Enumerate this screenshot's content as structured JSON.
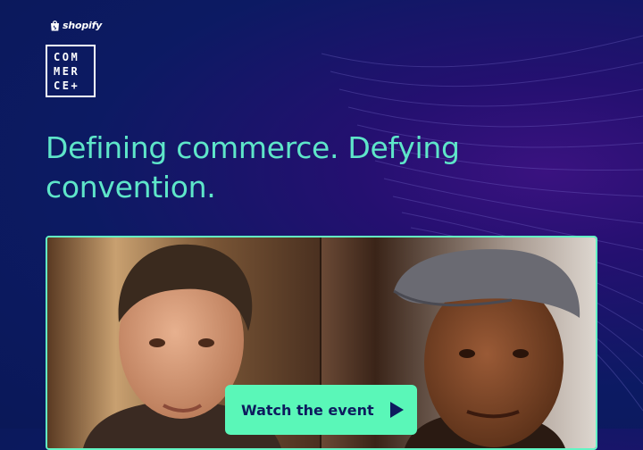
{
  "brand": {
    "name": "shopify",
    "icon": "shopify-bag-icon"
  },
  "logo": {
    "lines": [
      "COM",
      "MER",
      "CE+"
    ]
  },
  "hero": {
    "headline": "Defining commerce. Defying convention."
  },
  "video": {
    "description_icon": "video-thumbnail"
  },
  "cta": {
    "label": "Watch the event",
    "icon": "play-icon"
  },
  "colors": {
    "background": "#0c1a63",
    "accent_purple": "#3a1280",
    "headline": "#5ee6c9",
    "card_border": "#63f5c4",
    "button": "#5af7b8",
    "button_text": "#0d1b5e"
  }
}
